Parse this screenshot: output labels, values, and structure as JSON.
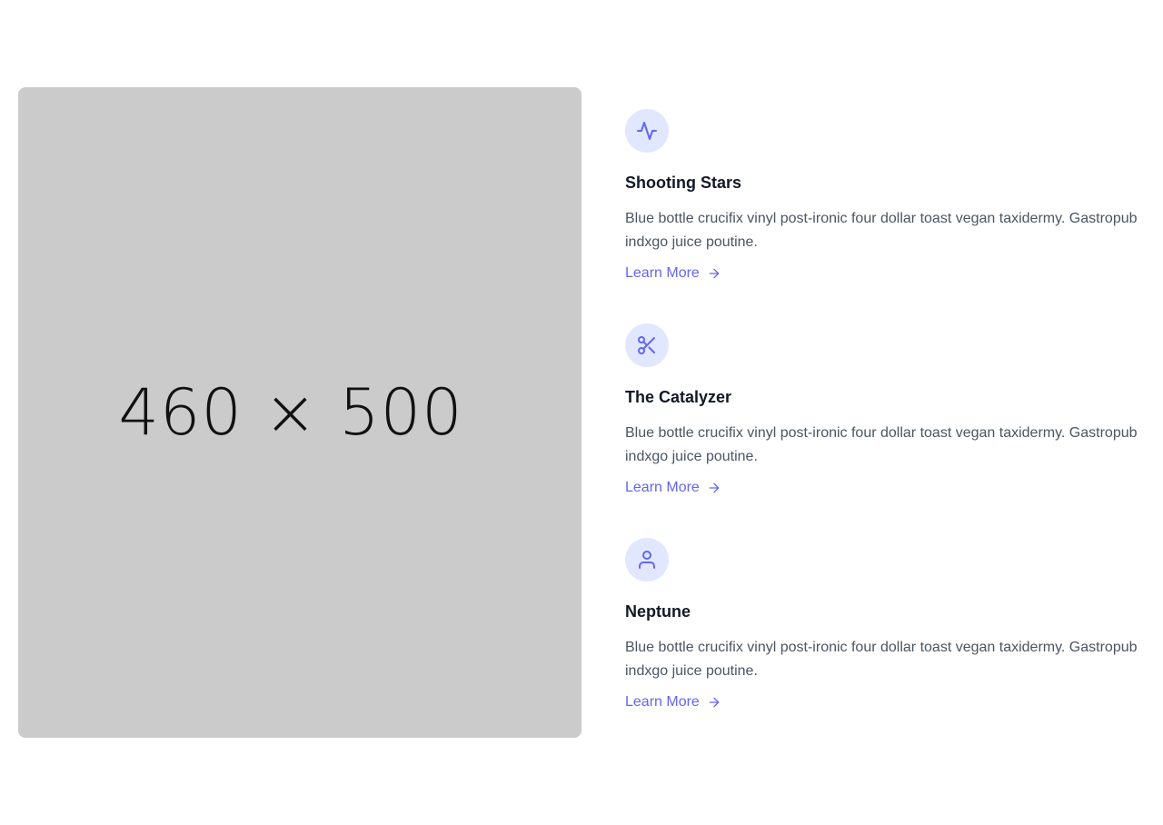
{
  "image": {
    "placeholder_text": "460 × 500"
  },
  "colors": {
    "accent": "#6366f1",
    "icon_bg": "#e0e7ff",
    "image_bg": "#cbcbcb",
    "title": "#111827",
    "body": "#4b5563"
  },
  "features": [
    {
      "icon": "activity-icon",
      "title": "Shooting Stars",
      "description": "Blue bottle crucifix vinyl post-ironic four dollar toast vegan taxidermy. Gastropub indxgo juice poutine.",
      "link_label": "Learn More"
    },
    {
      "icon": "scissors-icon",
      "title": "The Catalyzer",
      "description": "Blue bottle crucifix vinyl post-ironic four dollar toast vegan taxidermy. Gastropub indxgo juice poutine.",
      "link_label": "Learn More"
    },
    {
      "icon": "user-icon",
      "title": "Neptune",
      "description": "Blue bottle crucifix vinyl post-ironic four dollar toast vegan taxidermy. Gastropub indxgo juice poutine.",
      "link_label": "Learn More"
    }
  ]
}
